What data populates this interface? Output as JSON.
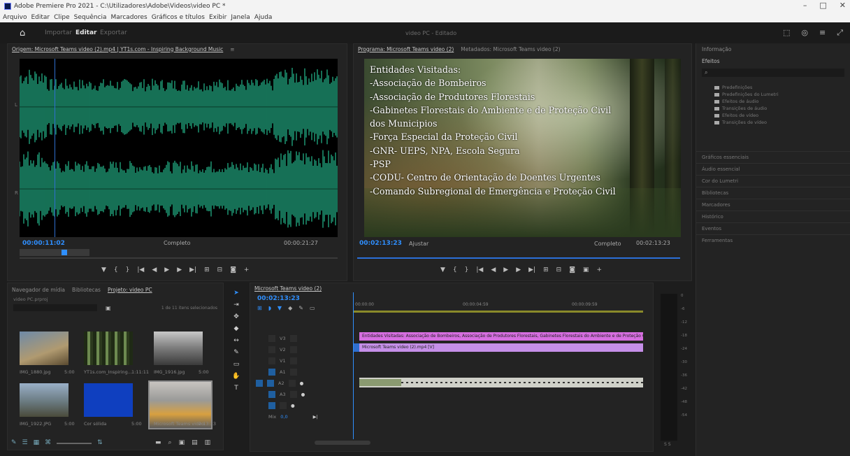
{
  "window": {
    "title": "Adobe Premiere Pro 2021 - C:\\Utilizadores\\Adobe\\Videos\\video PC *",
    "controls": [
      "–",
      "□",
      "✕"
    ]
  },
  "menu": [
    "Arquivo",
    "Editar",
    "Clipe",
    "Sequência",
    "Marcadores",
    "Gráficos e títulos",
    "Exibir",
    "Janela",
    "Ajuda"
  ],
  "workspace": {
    "tabs": [
      "Importar",
      "Editar",
      "Exportar"
    ],
    "active_tab": "Editar",
    "project_name": "video PC - Editado"
  },
  "source_monitor": {
    "header": "Origem: Microsoft Teams video (2).mp4 | YT1s.com - Inspiring Background Music",
    "timecode_left": "00:00:11:02",
    "timecode_right": "00:00:21:27",
    "fit": "Completo",
    "channels": [
      "L",
      "R"
    ]
  },
  "program_monitor": {
    "tab_active": "Programa: Microsoft Teams video (2)",
    "tab_other": "Metadados: Microsoft Teams video (2)",
    "timecode_left": "00:02:13:23",
    "fit_left": "Ajustar",
    "fit_right": "Completo",
    "timecode_right": "00:02:13:23",
    "overlay_lines": [
      "Entidades Visitadas:",
      "-Associação de Bombeiros",
      "-Associação de Produtores Florestais",
      "-Gabinetes Florestais do Ambiente e de Proteção Civil",
      " dos Municipios",
      "-Força Especial da Proteção Civil",
      "-GNR- UEPS, NPA, Escola Segura",
      "-PSP",
      "-CODU- Centro de Orientação de Doentes Urgentes",
      "-Comando Subregional de Emergência e Proteção Civil"
    ]
  },
  "right_panel": {
    "header": "Informação",
    "section": "Efeitos",
    "folders": [
      "Predefinições",
      "Predefinições do Lumetri",
      "Efeitos de áudio",
      "Transições de áudio",
      "Efeitos de vídeo",
      "Transições de vídeo"
    ],
    "sections": [
      "Gráficos essenciais",
      "Áudio essencial",
      "Cor do Lumetri",
      "Bibliotecas",
      "Marcadores",
      "Histórico",
      "Eventos",
      "Ferramentas"
    ]
  },
  "project_panel": {
    "tabs": [
      "Navegador de mídia",
      "Bibliotecas",
      "Projeto: video PC"
    ],
    "active_tab": "Projeto: video PC",
    "project_file": "video PC.prproj",
    "selection_info": "1 de 11 itens selecionados",
    "items": [
      {
        "name": "IMG_1880.jpg",
        "meta": "5:00"
      },
      {
        "name": "YT1s.com_Inspiring...",
        "meta": "1:11:11"
      },
      {
        "name": "IMG_1916.jpg",
        "meta": "5:00"
      },
      {
        "name": "IMG_1922.JPG",
        "meta": "5:00"
      },
      {
        "name": "Cor sólida",
        "meta": "5:00"
      },
      {
        "name": "Microsoft Teams video",
        "meta": "2:13:23"
      }
    ]
  },
  "timeline": {
    "tab": "Microsoft Teams video (2)",
    "timecode": "00:02:13:23",
    "ruler": [
      "00:00:00",
      "00:00:04:59",
      "00:00:09:59"
    ],
    "tracks": [
      "V3",
      "V2",
      "V1",
      "A1",
      "A2",
      "A3",
      "Mix"
    ],
    "clip_title": "Entidades Visitadas: Associação de Bombeiros, Associação de Produtores Florestais, Gabinetes Florestais do Ambiente e de Proteção Civil dos Municípios",
    "clip_video": "Microsoft Teams video (2).mp4 [V]",
    "mix_value": "0,0"
  },
  "meter": {
    "ticks": [
      "0",
      "-6",
      "-12",
      "-18",
      "-24",
      "-30",
      "-36",
      "-42",
      "-48",
      "-54"
    ],
    "footer": "S S"
  },
  "colors": {
    "waveform": "#1fa17a",
    "timecode": "#2f8fff",
    "clip_title": "#d66ee0",
    "clip_video": "#c58fe8",
    "accent": "#2b6fd8"
  }
}
